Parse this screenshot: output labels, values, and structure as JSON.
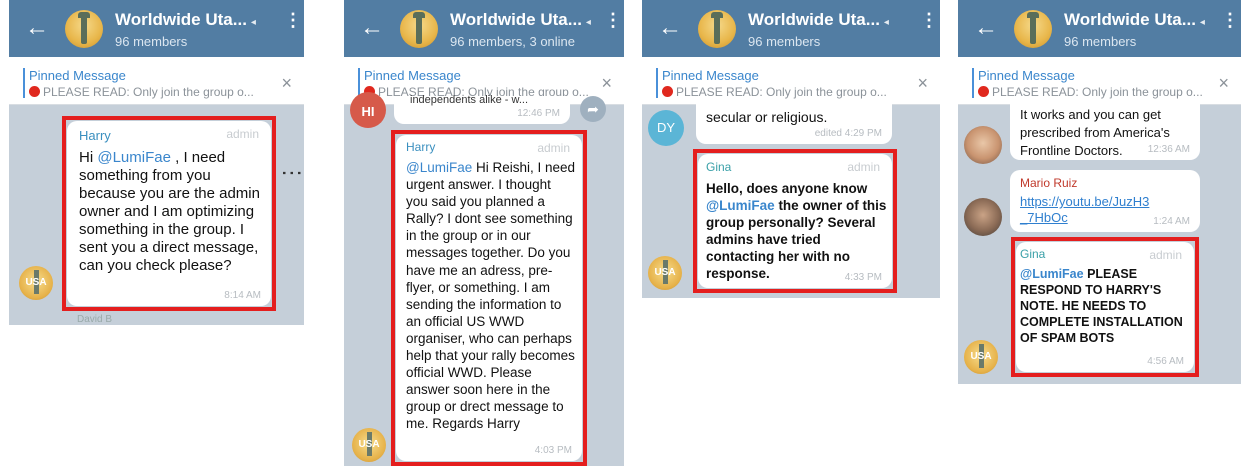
{
  "panels": [
    {
      "title": "Worldwide Uta...",
      "subtitle": "96 members",
      "pinned_title": "Pinned Message",
      "pinned_text": "PLEASE READ:  Only join the group o...",
      "message": {
        "sender": "Harry",
        "role": "admin",
        "mention": "@LumiFae",
        "text": " , I need something from you because you are the admin owner and I am optimizing something in the group. I sent you a direct message, can you check please?",
        "text_prefix": "Hi ",
        "time": "8:14 AM"
      },
      "more_icon": "⋮",
      "bottom_fragment": "David B"
    },
    {
      "title": "Worldwide Uta...",
      "subtitle": "96 members, 3 online",
      "pinned_title": "Pinned Message",
      "pinned_text": "PLEASE READ:  Only join the group o...",
      "prev_fragment": "independents alike - w...",
      "prev_time": "12:46 PM",
      "prev_avatar": "HI",
      "message": {
        "sender": "Harry",
        "role": "admin",
        "mention": "@LumiFae",
        "text_prefix": "",
        "text": " Hi Reishi, I need urgent answer. I thought you said you planned a Rally? I dont see something in the group or in our messages together. Do you have me an adress, pre-flyer, or something. I am sending the information to an official US WWD organiser, who can perhaps help that your rally becomes official WWD. Please answer soon here in the group or drect message to me. Regards Harry",
        "time": "4:03 PM"
      },
      "avatar_label": "USA"
    },
    {
      "title": "Worldwide Uta...",
      "subtitle": "96 members",
      "pinned_title": "Pinned Message",
      "pinned_text": "PLEASE READ:  Only join the group o...",
      "prev_fragment": "secular or religious.",
      "prev_time": "edited 4:29 PM",
      "prev_avatar": "DY",
      "message": {
        "sender": "Gina",
        "role": "admin",
        "mention": "@LumiFae",
        "text_prefix": "Hello, does anyone know ",
        "text": " the owner of this group personally? Several admins have tried contacting her with no response.",
        "time": "4:33 PM"
      },
      "avatar_label": "USA"
    },
    {
      "title": "Worldwide Uta...",
      "subtitle": "96 members",
      "pinned_title": "Pinned Message",
      "pinned_text": "PLEASE READ:  Only join the group o...",
      "prev_fragment": "It works and you can get prescribed from America's Frontline Doctors.",
      "prev_time": "12:36 AM",
      "link_message": {
        "sender": "Mario Ruiz",
        "link": "https://youtu.be/JuzH3_7HbOc",
        "link_line1": "https://youtu.be/JuzH3",
        "link_line2": "_7HbOc",
        "time": "1:24 AM"
      },
      "message": {
        "sender": "Gina",
        "role": "admin",
        "mention": "@LumiFae",
        "text_prefix": "",
        "text": " PLEASE RESPOND TO HARRY'S NOTE. HE NEEDS TO COMPLETE INSTALLATION OF SPAM BOTS",
        "time": "4:56 AM"
      },
      "avatar_label": "USA"
    }
  ],
  "icons": {
    "back": "←",
    "menu": "⋮",
    "close": "×",
    "mute": "◂",
    "forward": "➦"
  },
  "colors": {
    "header": "#527da3",
    "highlight_box": "#e41e1e",
    "mention": "#3a86cc",
    "sender_harry": "#3a8fbf",
    "sender_gina": "#3aa0a8",
    "sender_mario": "#c0392b"
  }
}
